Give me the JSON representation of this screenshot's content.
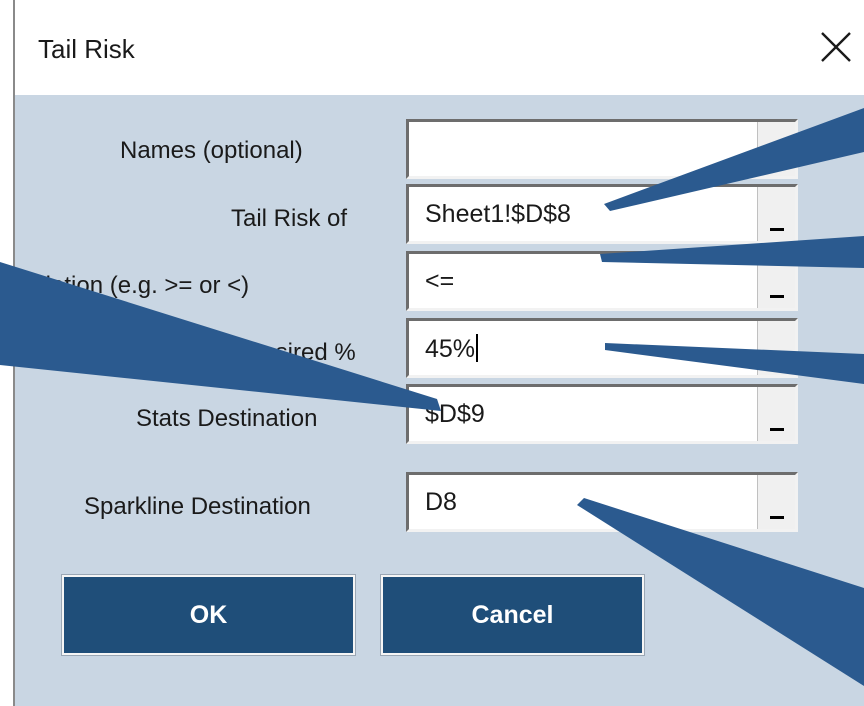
{
  "dialog": {
    "title": "Tail Risk",
    "close_glyph": "×"
  },
  "fields": [
    {
      "label": "Names (optional)",
      "value": "",
      "has_ref_bar": false
    },
    {
      "label": "Tail Risk of",
      "value": "Sheet1!$D$8",
      "has_ref_bar": true
    },
    {
      "label": "Relation (e.g. >= or <)",
      "value": "<=",
      "has_ref_bar": true
    },
    {
      "label": "Desired %",
      "value": "45%",
      "has_ref_bar": false
    },
    {
      "label": "Stats Destination",
      "value": "$D$9",
      "has_ref_bar": true
    },
    {
      "label": "Sparkline Destination",
      "value": "D8",
      "has_ref_bar": true
    }
  ],
  "buttons": {
    "ok_label": "OK",
    "cancel_label": "Cancel"
  },
  "colors": {
    "dialog_background": "#c9d6e3",
    "button_background": "#1f4e79",
    "callout_color": "#2b5a8f"
  },
  "icons": {
    "close": "close-icon",
    "range_select": "range-select-icon"
  }
}
